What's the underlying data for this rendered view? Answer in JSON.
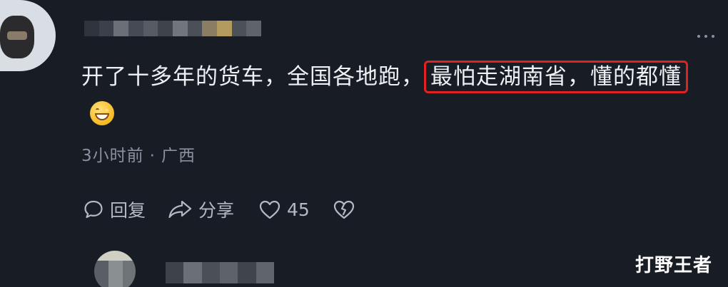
{
  "comment": {
    "text_before": "开了十多年的货车，全国各地跑，",
    "highlight": "最怕走湖南省，懂的都懂",
    "emoji": "grinning-face-icon",
    "highlight_color": "#e02222"
  },
  "meta": {
    "time": "3小时前",
    "separator": "·",
    "location": "广西"
  },
  "actions": {
    "reply_label": "回复",
    "share_label": "分享",
    "like_count": "45"
  },
  "watermark": "打野王者",
  "colors": {
    "background": "#171c25",
    "text": "#eef0f4",
    "muted": "#8b90a0"
  }
}
